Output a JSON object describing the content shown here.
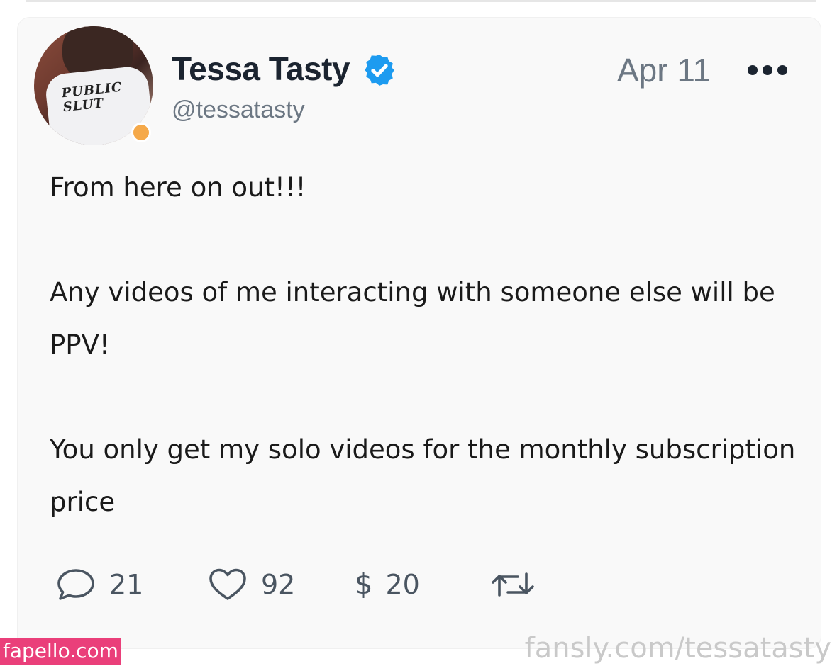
{
  "post": {
    "author": {
      "display_name": "Tessa Tasty",
      "handle": "@tessatasty",
      "avatar_shirt_text": "PUBLIC SLUT",
      "verified": true,
      "online_status_color": "#f5a94a"
    },
    "date": "Apr 11",
    "body": {
      "line1": "From here on out!!!",
      "line2": "Any videos of me interacting with someone else will be PPV!",
      "line3": "You only get my solo videos for the monthly subscription price"
    },
    "actions": {
      "comments": "21",
      "likes": "92",
      "tip_symbol": "$",
      "tips": "20",
      "repost_icon": "repost-icon"
    }
  },
  "watermarks": {
    "left": "fapello.com",
    "right": "fansly.com/tessatasty"
  },
  "colors": {
    "verified_badge": "#1d9bf0",
    "icon": "#4a5561",
    "watermark_left_bg": "#ea3f7a"
  }
}
